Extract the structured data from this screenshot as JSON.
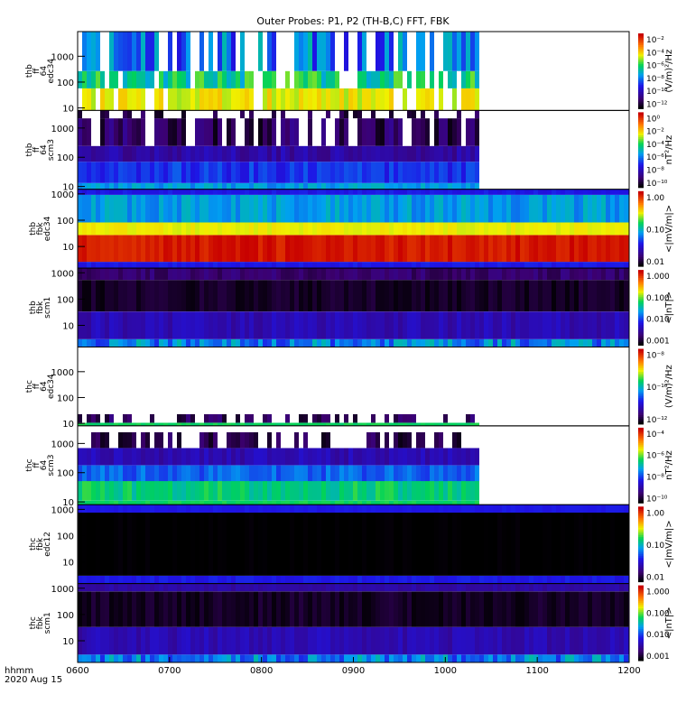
{
  "chart_data": {
    "type": "heatmap",
    "title": "Outer Probes: P1, P2 (TH-B,C) FFT, FBK",
    "xlabel": "hhmm",
    "date_label": "2020 Aug 15",
    "x_ticks": [
      "0600",
      "0700",
      "0800",
      "0900",
      "1000",
      "1100",
      "1200"
    ],
    "x_range_hours": [
      6,
      12
    ],
    "panels": [
      {
        "label": [
          "thb",
          "ff",
          "64",
          "edc34"
        ],
        "ylim": [
          8,
          9000
        ],
        "y_ticks": [
          "1000",
          "100",
          "10"
        ],
        "data_end_hour": 10.37,
        "colorbar": {
          "unit": "(V/m)²/Hz",
          "ticks": [
            "10⁻²",
            "10⁻⁴",
            "10⁻⁶",
            "10⁻⁸",
            "10⁻¹⁰",
            "10⁻¹²"
          ]
        }
      },
      {
        "label": [
          "thb",
          "ff",
          "64",
          "scm3"
        ],
        "ylim": [
          8,
          4000
        ],
        "y_ticks": [
          "1000",
          "100",
          "10"
        ],
        "data_end_hour": 10.37,
        "colorbar": {
          "unit": "nT²/Hz",
          "ticks": [
            "10⁰",
            "10⁻²",
            "10⁻⁴",
            "10⁻⁶",
            "10⁻⁸",
            "10⁻¹⁰"
          ]
        }
      },
      {
        "label": [
          "thb",
          "fbk",
          "edc34"
        ],
        "ylim": [
          1.5,
          1500
        ],
        "y_ticks": [
          "1000",
          "100",
          "10"
        ],
        "data_end_hour": 12,
        "colorbar": {
          "unit": "<|mV/m|>",
          "ticks": [
            "1.00",
            "0.10",
            "0.01"
          ]
        }
      },
      {
        "label": [
          "thb",
          "fbk",
          "scm1"
        ],
        "ylim": [
          1.5,
          1500
        ],
        "y_ticks": [
          "1000",
          "100",
          "10"
        ],
        "data_end_hour": 12,
        "colorbar": {
          "unit": "<|nT|>",
          "ticks": [
            "1.000",
            "0.100",
            "0.010",
            "0.001"
          ]
        }
      },
      {
        "label": [
          "thc",
          "ff",
          "64",
          "edc34"
        ],
        "ylim": [
          8,
          9000
        ],
        "y_ticks": [
          "1000",
          "100",
          "10"
        ],
        "data_end_hour": 10.37,
        "colorbar": {
          "unit": "(V/m)²/Hz",
          "ticks": [
            "10⁻⁸",
            "10⁻¹⁰",
            "10⁻¹²"
          ]
        }
      },
      {
        "label": [
          "thc",
          "ff",
          "64",
          "scm3"
        ],
        "ylim": [
          8,
          4000
        ],
        "y_ticks": [
          "1000",
          "100",
          "10"
        ],
        "data_end_hour": 10.37,
        "colorbar": {
          "unit": "nT²/Hz",
          "ticks": [
            "10⁻⁴",
            "10⁻⁶",
            "10⁻⁸",
            "10⁻¹⁰"
          ]
        }
      },
      {
        "label": [
          "thc",
          "fbk",
          "edc12"
        ],
        "ylim": [
          1.5,
          1500
        ],
        "y_ticks": [
          "1000",
          "100",
          "10"
        ],
        "data_end_hour": 12,
        "colorbar": {
          "unit": "<|mV/m|>",
          "ticks": [
            "1.00",
            "0.10",
            "0.01"
          ]
        }
      },
      {
        "label": [
          "thc",
          "fbk",
          "scm1"
        ],
        "ylim": [
          1.5,
          1500
        ],
        "y_ticks": [
          "1000",
          "100",
          "10"
        ],
        "data_end_hour": 12,
        "colorbar": {
          "unit": "<|nT|>",
          "ticks": [
            "1.000",
            "0.100",
            "0.010",
            "0.001"
          ]
        }
      }
    ]
  }
}
